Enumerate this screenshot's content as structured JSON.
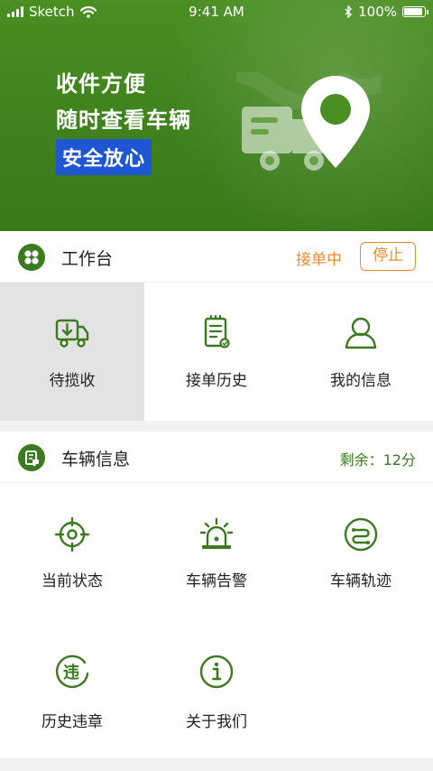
{
  "status_bar": {
    "carrier": "Sketch",
    "time": "9:41 AM",
    "battery": "100%"
  },
  "banner": {
    "line1": "收件方便",
    "line2": "随时查看车辆",
    "badge": "安全放心"
  },
  "workbench": {
    "title": "工作台",
    "status": "接单中",
    "stop_label": "停止",
    "items": [
      {
        "label": "待揽收",
        "icon": "truck-download-icon",
        "selected": true
      },
      {
        "label": "接单历史",
        "icon": "clipboard-icon",
        "selected": false
      },
      {
        "label": "我的信息",
        "icon": "user-icon",
        "selected": false
      }
    ]
  },
  "vehicle": {
    "title": "车辆信息",
    "remaining": "剩余：12分",
    "items": [
      {
        "label": "当前状态",
        "icon": "target-icon"
      },
      {
        "label": "车辆告警",
        "icon": "alarm-light-icon"
      },
      {
        "label": "车辆轨迹",
        "icon": "route-icon"
      },
      {
        "label": "历史违章",
        "icon": "violation-icon"
      },
      {
        "label": "关于我们",
        "icon": "info-icon"
      }
    ]
  },
  "colors": {
    "brand_green": "#3a7b1e",
    "accent_orange": "#f08a2b",
    "badge_blue": "#1f56d6"
  }
}
